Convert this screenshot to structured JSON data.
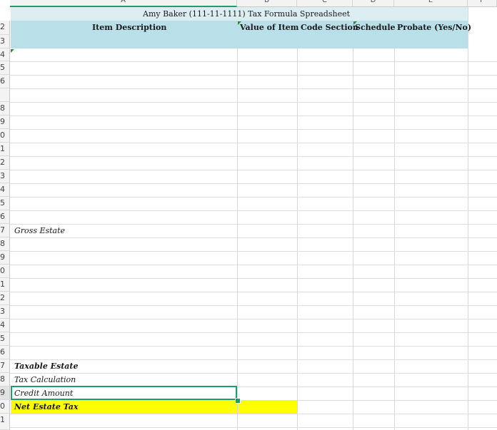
{
  "columns": [
    "A",
    "B",
    "C",
    "D",
    "E",
    "F"
  ],
  "rows": [
    "2",
    "3",
    "4",
    "5",
    "6",
    "",
    "8",
    "9",
    "0",
    "1",
    "2",
    "3",
    "4",
    "5",
    "6",
    "7",
    "8",
    "9",
    "0",
    "1",
    "2",
    "3",
    "4",
    "5",
    "6",
    "7",
    "8",
    "9",
    "0",
    "1"
  ],
  "sheet": {
    "title": "Amy Baker (111-11-1111) Tax Formula Spreadsheet",
    "headers": {
      "item_description": "Item Description",
      "value_of_item": "Value of Item",
      "code_section": "Code Section",
      "schedule": "Schedule",
      "probate": "Probate (Yes/No)"
    },
    "labels": {
      "gross_estate": "Gross Estate",
      "taxable_estate": "Taxable Estate",
      "tax_calculation": "Tax Calculation",
      "credit_amount": "Credit Amount",
      "net_estate_tax": "Net Estate Tax"
    }
  },
  "colors": {
    "title_fill": "#ddeef3",
    "header_fill": "#b9dfe8",
    "highlight_fill": "#ffff00",
    "selection": "#1e9e6a"
  }
}
